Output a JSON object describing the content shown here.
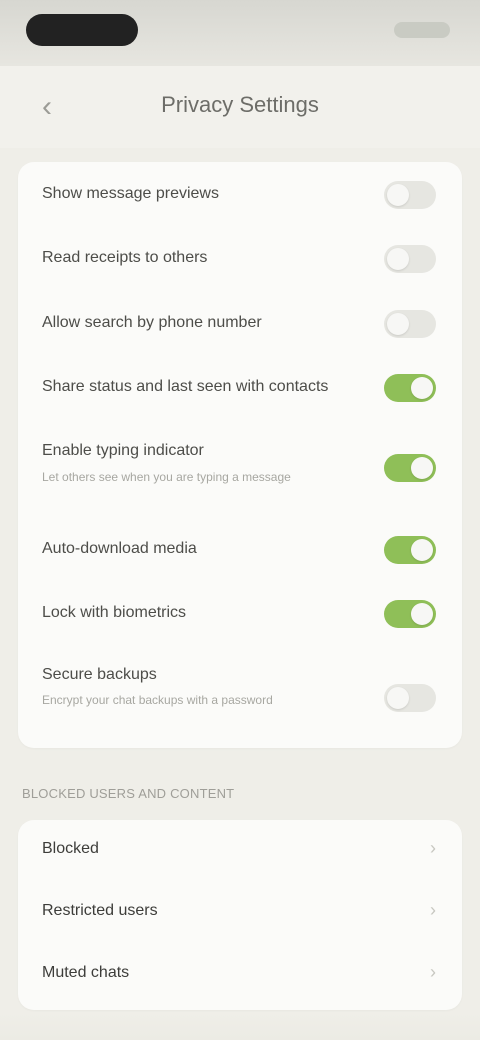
{
  "header": {
    "title": "Privacy Settings",
    "back_icon": "chevron-left-icon"
  },
  "toggles": [
    {
      "label": "Show message previews",
      "sub": "",
      "on": false
    },
    {
      "label": "Read receipts to others",
      "sub": "",
      "on": false
    },
    {
      "label": "Allow search by phone number",
      "sub": "",
      "on": false
    },
    {
      "label": "Share status and last seen with contacts",
      "sub": "",
      "on": true
    },
    {
      "label": "Enable typing indicator",
      "sub": "Let others see when you are typing a message",
      "on": true
    },
    {
      "label": "Auto-download media",
      "sub": "",
      "on": true
    },
    {
      "label": "Lock with biometrics",
      "sub": "",
      "on": true
    },
    {
      "label": "Secure backups",
      "sub": "Encrypt your chat backups with a password",
      "on": false
    }
  ],
  "section": {
    "header": "BLOCKED USERS AND CONTENT",
    "items": [
      {
        "label": "Blocked"
      },
      {
        "label": "Restricted users"
      },
      {
        "label": "Muted chats"
      }
    ]
  },
  "colors": {
    "toggle_on": "#8fbf58",
    "toggle_off": "#e6e6e1",
    "background": "#efeee8",
    "card": "#fbfbf9"
  }
}
